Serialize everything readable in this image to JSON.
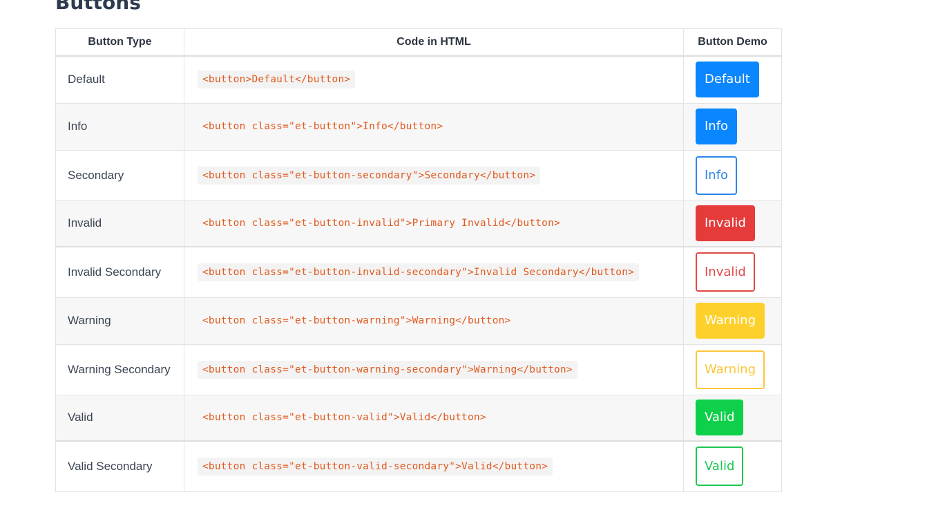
{
  "page": {
    "title": "Buttons"
  },
  "table": {
    "headers": [
      "Button Type",
      "Code in HTML",
      "Button Demo"
    ],
    "rows": [
      {
        "type": "Default",
        "code": "<button>Default</button>",
        "demo": "Default"
      },
      {
        "type": "Info",
        "code": "<button class=\"et-button\">Info</button>",
        "demo": "Info"
      },
      {
        "type": "Secondary",
        "code": "<button class=\"et-button-secondary\">Secondary</button>",
        "demo": "Info"
      },
      {
        "type": "Invalid",
        "code": "<button class=\"et-button-invalid\">Primary Invalid</button>",
        "demo": "Invalid"
      },
      {
        "type": "Invalid Secondary",
        "code": "<button class=\"et-button-invalid-secondary\">Invalid Secondary</button>",
        "demo": "Invalid"
      },
      {
        "type": "Warning",
        "code": "<button class=\"et-button-warning\">Warning</button>",
        "demo": "Warning"
      },
      {
        "type": "Warning Secondary",
        "code": "<button class=\"et-button-warning-secondary\">Warning</button>",
        "demo": "Warning"
      },
      {
        "type": "Valid",
        "code": "<button class=\"et-button-valid\">Valid</button>",
        "demo": "Valid"
      },
      {
        "type": "Valid Secondary",
        "code": "<button class=\"et-button-valid-secondary\">Valid</button>",
        "demo": "Valid"
      }
    ]
  },
  "colors": {
    "primary_blue": "#0a86ff",
    "invalid_red": "#e53b3b",
    "warning_yellow": "#fdd02b",
    "valid_green": "#0fd04a",
    "code_text": "#e05a1f"
  }
}
